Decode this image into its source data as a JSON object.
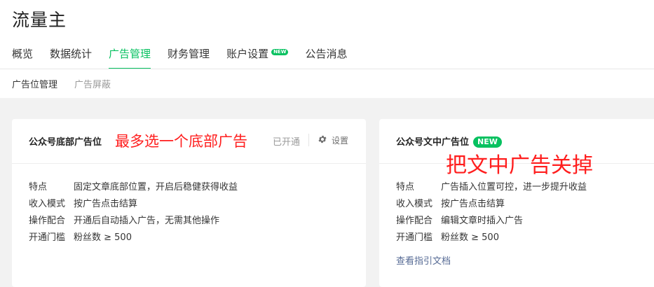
{
  "brand": "流量主",
  "nav": {
    "tabs": [
      {
        "label": "概览"
      },
      {
        "label": "数据统计"
      },
      {
        "label": "广告管理"
      },
      {
        "label": "财务管理"
      },
      {
        "label": "账户设置",
        "badge": "NEW"
      },
      {
        "label": "公告消息"
      }
    ],
    "active": "广告管理"
  },
  "subnav": {
    "items": [
      {
        "label": "广告位管理"
      },
      {
        "label": "广告屏蔽"
      }
    ]
  },
  "cards": {
    "bottom": {
      "title": "公众号底部广告位",
      "status": "已开通",
      "settings_label": "设置",
      "annotation": "最多选一个底部广告",
      "rows": [
        {
          "k": "特点",
          "v": "固定文章底部位置，开启后稳健获得收益"
        },
        {
          "k": "收入模式",
          "v": "按广告点击结算"
        },
        {
          "k": "操作配合",
          "v": "开通后自动插入广告，无需其他操作"
        },
        {
          "k": "开通门槛",
          "v": "粉丝数 ≥ 500"
        }
      ]
    },
    "inline": {
      "title": "公众号文中广告位",
      "badge": "NEW",
      "annotation": "把文中广告关掉",
      "rows": [
        {
          "k": "特点",
          "v": "广告插入位置可控，进一步提升收益"
        },
        {
          "k": "收入模式",
          "v": "按广告点击结算"
        },
        {
          "k": "操作配合",
          "v": "编辑文章时插入广告"
        },
        {
          "k": "开通门槛",
          "v": "粉丝数 ≥ 500"
        }
      ],
      "doc_link": "查看指引文档"
    }
  },
  "colors": {
    "accent": "#07c160",
    "annotation": "#ff1e1e",
    "link": "#576b95"
  }
}
